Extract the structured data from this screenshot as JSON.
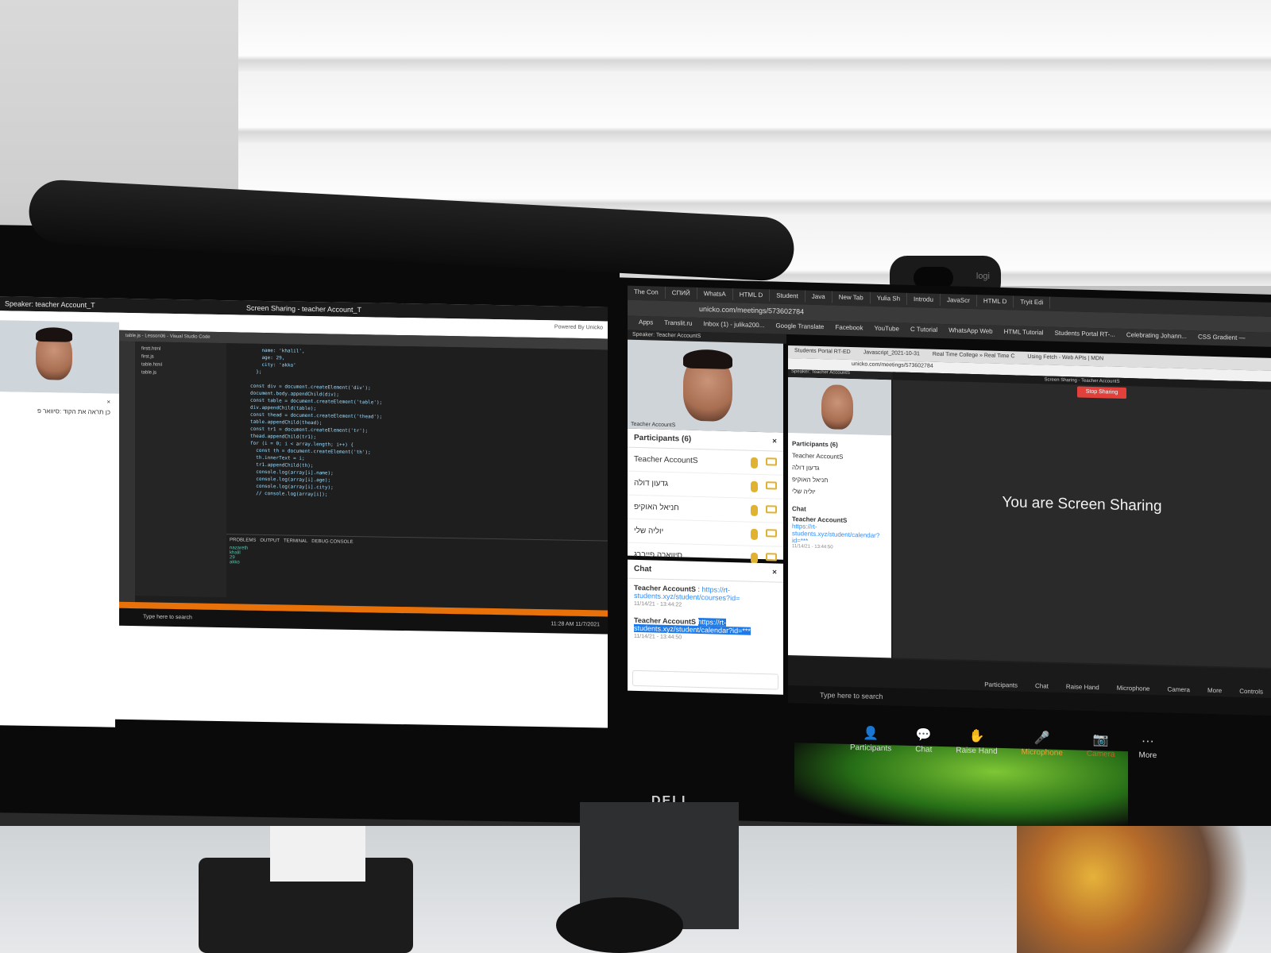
{
  "left_screen": {
    "title": "Screen Sharing - teacher Account_T",
    "speaker": "Speaker: teacher Account_T",
    "powered": "Powered By Unicko",
    "chat_message": "כן תראה את הקוד :סיוואר פ",
    "chat_close": "×",
    "vscode_title": "table.js - Lesson06 - Visual Studio Code",
    "vscode_tabs": [
      "table.html",
      "table.js"
    ],
    "explorer_files": [
      "firstt.html",
      "first.js",
      "table.html",
      "table.js"
    ],
    "code_lines": [
      "    name: 'khalil',",
      "    age: 29,",
      "    city: 'akko'",
      "  };",
      "",
      "const div = document.createElement('div');",
      "document.body.appendChild(div);",
      "const table = document.createElement('table');",
      "div.appendChild(table);",
      "const thead = document.createElement('thead');",
      "table.appendChild(thead);",
      "const tr1 = document.createElement('tr');",
      "thead.appendChild(tr1);",
      "for (i = 0; i < array.length; i++) {",
      "  const th = document.createElement('th');",
      "  th.innerText = i;",
      "  tr1.appendChild(th);",
      "  console.log(array[i].name);",
      "  console.log(array[i].age);",
      "  console.log(array[i].city);",
      "  // console.log(array[i]);"
    ],
    "panel_tabs": [
      "PROBLEMS",
      "OUTPUT",
      "TERMINAL",
      "DEBUG CONSOLE"
    ],
    "console_output": [
      "nazareth",
      "khalil",
      "29",
      "akko"
    ],
    "taskbar_search": "Type here to search",
    "taskbar_clock": "11:28 AM 11/7/2021"
  },
  "right_screen": {
    "browser_tabs": [
      "The Con",
      "СПИЙ",
      "WhatsA",
      "HTML D",
      "Student",
      "Java",
      "New Tab",
      "Yulia Sh",
      "Introdu",
      "JavaScr",
      "HTML D",
      "Tryit Edi"
    ],
    "url": "unicko.com/meetings/573602784",
    "bookmarks": [
      "Apps",
      "Translit.ru",
      "Inbox (1) - julika200...",
      "Google Translate",
      "Facebook",
      "YouTube",
      "C Tutorial",
      "WhatsApp Web",
      "HTML Tutorial",
      "Students Portal RT-...",
      "Celebrating Johann...",
      "CSS Gradient —"
    ],
    "speaker": "Speaker: Teacher AccountS",
    "video_caption": "Teacher AccountS",
    "participants_title": "Participants (6)",
    "participants": [
      "Teacher AccountS",
      "גדעון דולה",
      "חניאל האוקיפ",
      "יוליה שלי",
      "סיווארה פייברג"
    ],
    "chat_title": "Chat",
    "messages": [
      {
        "from": "Teacher AccountS",
        "link": "https://rt-students.xyz/student/courses?id=",
        "time": "11/14/21 - 13:44:22"
      },
      {
        "from": "Teacher AccountS",
        "link": "https://rt-students.xyz/student/calendar?id=***",
        "time": "11/14/21 - 13:44:50"
      }
    ],
    "inner_tabs": [
      "Students Portal RT-ED",
      "Javascript_2021-10-31",
      "Real Time College » Real Time C",
      "Using Fetch - Web APIs | MDN"
    ],
    "inner_url": "unicko.com/meetings/573602784",
    "inner_speaker": "Speaker: Teacher AccountS",
    "inner_title": "Screen Sharing - Teacher AccountS",
    "stop_sharing": "Stop Sharing",
    "inner_participants_title": "Participants (6)",
    "inner_participants": [
      "Teacher AccountS",
      "גדעון דולה",
      "חניאל האוקיפ",
      "יוליה שלי"
    ],
    "inner_chat_title": "Chat",
    "inner_chat_from": "Teacher AccountS",
    "inner_chat_link": "https://rt-students.xyz/student/calendar?id=***",
    "inner_chat_time": "11/14/21 - 13:44:50",
    "sharing_message": "You are Screen Sharing",
    "inner_toolbar": [
      "Participants",
      "Chat",
      "Raise Hand",
      "Microphone",
      "Camera",
      "More",
      "Controls"
    ],
    "participant_count": "6",
    "inner_task_search": "Type here to search",
    "main_toolbar": [
      "Participants",
      "Chat",
      "Raise Hand",
      "Microphone",
      "Camera",
      "More"
    ]
  },
  "brand": "DELL",
  "webcam_brand": "logi"
}
